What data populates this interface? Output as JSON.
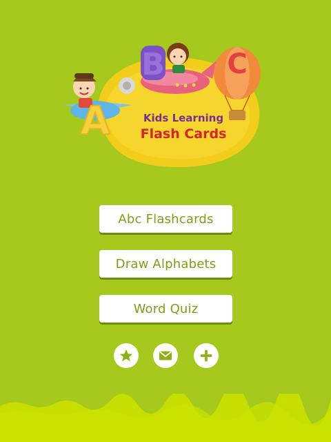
{
  "logo": {
    "line1": "Kids Learning",
    "line2": "Flash Cards",
    "letters": [
      "A",
      "B",
      "C"
    ]
  },
  "menu": {
    "items": [
      {
        "label": "Abc Flashcards"
      },
      {
        "label": "Draw Alphabets"
      },
      {
        "label": "Word Quiz"
      }
    ]
  },
  "icons": {
    "rate": "star-icon",
    "contact": "mail-icon",
    "more": "plus-icon"
  },
  "colors": {
    "background": "#a5c91c",
    "ground": "#c8e000",
    "button_text": "#7aa012",
    "logo_blob": "#f5d21e",
    "title_purple": "#7a2f8f",
    "title_red": "#d8232a"
  }
}
